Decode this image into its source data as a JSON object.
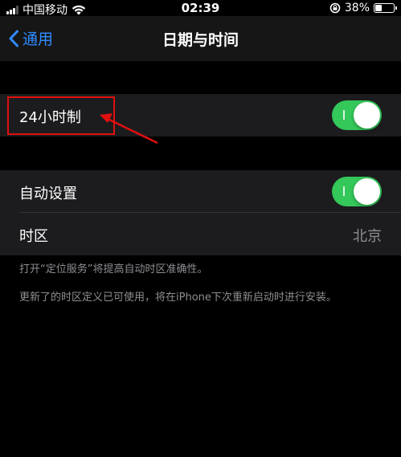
{
  "status_bar": {
    "carrier": "中国移动",
    "time": "02:39",
    "battery_text": "38%",
    "battery_level": 0.38,
    "icons": [
      "signal-icon",
      "wifi-icon",
      "rotation-lock-icon",
      "battery-icon"
    ]
  },
  "nav": {
    "back_label": "通用",
    "title": "日期与时间"
  },
  "group1": {
    "row_24h": {
      "label": "24小时制",
      "on": true
    }
  },
  "group2": {
    "row_auto": {
      "label": "自动设置",
      "on": true
    },
    "row_timezone": {
      "label": "时区",
      "value": "北京"
    }
  },
  "footer": {
    "note1": "打开“定位服务”将提高自动时区准确性。",
    "note2": "更新了的时区定义已可使用，将在iPhone下次重新启动时进行安装。"
  },
  "colors": {
    "accent": "#2f8cff",
    "toggle_on": "#34c759",
    "annotation": "#e01010",
    "background": "#000000",
    "cell": "#1c1c1e"
  }
}
